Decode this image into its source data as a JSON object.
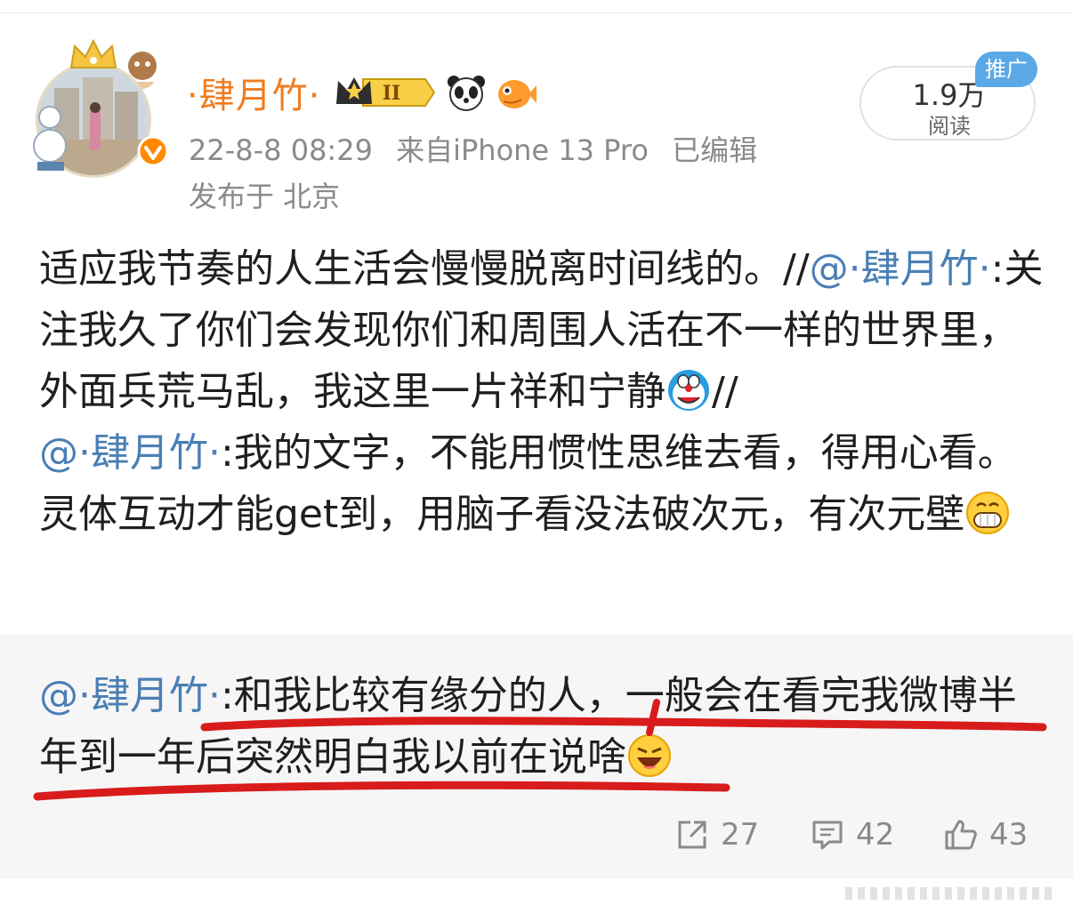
{
  "post": {
    "username": "·肆月竹·",
    "vip_level": "II",
    "timestamp": "22-8-8 08:29",
    "source": "来自iPhone 13 Pro",
    "edited": "已编辑",
    "location": "发布于 北京",
    "read_count": "1.9万",
    "read_label": "阅读",
    "ad_badge": "推广",
    "text_part1": "适应我节奏的人生活会慢慢脱离时间线的。//",
    "mention1": "@·肆月竹·",
    "text_part2": ":关注我久了你们会发现你们和周围人活在不一样的世界里，外面兵荒马乱，我这里一片祥和宁静",
    "sep2": "//",
    "mention2": "@·肆月竹·",
    "text_part3": ":我的文字，不能用惯性思维去看，得用心看。灵体互动才能get到，用脑子看没法破次元，有次元壁",
    "badges": [
      "vip-crown-badge",
      "panda-icon",
      "fish-icon"
    ],
    "inline_emojis": [
      "doraemon-emoji",
      "grin-emoji"
    ]
  },
  "repost": {
    "mention": "@·肆月竹·",
    "text": ":和我比较有缘分的人，一般会在看完我微博半年到一年后突然明白我以前在说啥",
    "emoji": "laugh-emoji",
    "annotation_color": "#d81c1c"
  },
  "actions": {
    "repost_count": "27",
    "comment_count": "42",
    "like_count": "43"
  },
  "colors": {
    "username": "#f07c1e",
    "mention": "#4a7fb5",
    "meta": "#8a8a8a",
    "ad_badge": "#5aa9e6"
  }
}
